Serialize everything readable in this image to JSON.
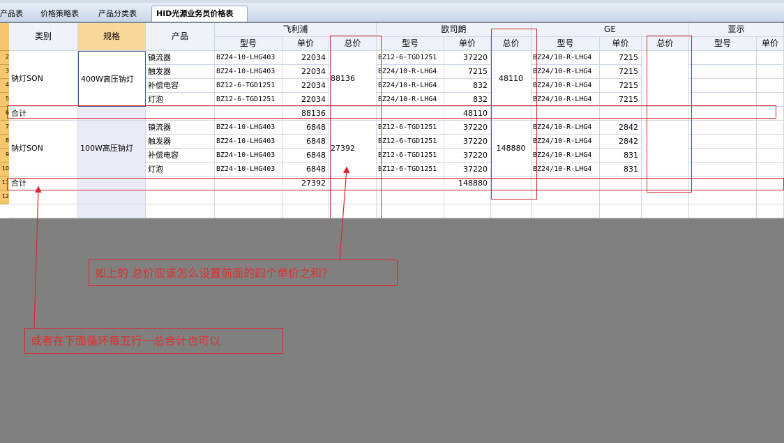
{
  "tabs": [
    {
      "label": "产品表",
      "active": false
    },
    {
      "label": "价格策略表",
      "active": false
    },
    {
      "label": "产品分类表",
      "active": false
    },
    {
      "label": "HID光源业务员价格表",
      "active": true
    }
  ],
  "header": {
    "category": "类别",
    "spec": "规格",
    "product": "产品",
    "brands": [
      "飞利浦",
      "欧司朗",
      "GE",
      "亚示"
    ],
    "model": "型号",
    "unit_price": "单价",
    "total_price": "总价"
  },
  "row_numbers": [
    "",
    "2",
    "3",
    "4",
    "5",
    "6",
    "7",
    "8",
    "9",
    "10",
    "11",
    "12"
  ],
  "groups": [
    {
      "category": "钠灯SON",
      "spec": "400W高压钠灯",
      "rows": [
        {
          "product": "镇流器",
          "ph_model": "BZ24-10-LHG403",
          "ph_price": "22034",
          "os_model": "BZ12-6-TGD1251",
          "os_price": "37220",
          "ge_model": "BZ24/10-R-LHG4",
          "ge_price": "7215"
        },
        {
          "product": "触发器",
          "ph_model": "BZ24-10-LHG403",
          "ph_price": "22034",
          "os_model": "BZ24/10-R-LHG4",
          "os_price": "7215",
          "ge_model": "BZ24/10-R-LHG4",
          "ge_price": "7215"
        },
        {
          "product": "补偿电容",
          "ph_model": "BZ12-6-TGD1251",
          "ph_price": "22034",
          "os_model": "BZ24/10-R-LHG4",
          "os_price": "832",
          "ge_model": "BZ24/10-R-LHG4",
          "ge_price": "7215"
        },
        {
          "product": "灯泡",
          "ph_model": "BZ12-6-TGD1251",
          "ph_price": "22034",
          "os_model": "BZ24/10-R-LHG4",
          "os_price": "832",
          "ge_model": "BZ24/10-R-LHG4",
          "ge_price": "7215"
        }
      ],
      "ph_total": "88136",
      "os_total": "48110",
      "sum_label": "合计",
      "sum_ph": "88136",
      "sum_os": "48110"
    },
    {
      "category": "钠灯SON",
      "spec": "100W高压钠灯",
      "rows": [
        {
          "product": "镇流器",
          "ph_model": "BZ24-10-LHG403",
          "ph_price": "6848",
          "os_model": "BZ12-6-TGD1251",
          "os_price": "37220",
          "ge_model": "BZ24/10-R-LHG4",
          "ge_price": "2842"
        },
        {
          "product": "触发器",
          "ph_model": "BZ24-10-LHG403",
          "ph_price": "6848",
          "os_model": "BZ12-6-TGD1251",
          "os_price": "37220",
          "ge_model": "BZ24/10-R-LHG4",
          "ge_price": "2842"
        },
        {
          "product": "补偿电容",
          "ph_model": "BZ24-10-LHG403",
          "ph_price": "6848",
          "os_model": "BZ12-6-TGD1251",
          "os_price": "37220",
          "ge_model": "BZ24/10-R-LHG4",
          "ge_price": "831"
        },
        {
          "product": "灯泡",
          "ph_model": "BZ24-10-LHG403",
          "ph_price": "6848",
          "os_model": "BZ12-6-TGD1251",
          "os_price": "37220",
          "ge_model": "BZ24/10-R-LHG4",
          "ge_price": "831"
        }
      ],
      "ph_total": "27392",
      "os_total": "148880",
      "sum_label": "合计",
      "sum_ph": "27392",
      "sum_os": "148880"
    }
  ],
  "annotations": {
    "question_1": "如上的 总价应该怎么设置前面的四个单价之和？",
    "question_2": "或者在下面循环每五行一总合计也可以"
  },
  "colors": {
    "annotation": "#d9272b",
    "row_header": "#f7c66d",
    "selected_column": "#e9ecf6"
  }
}
